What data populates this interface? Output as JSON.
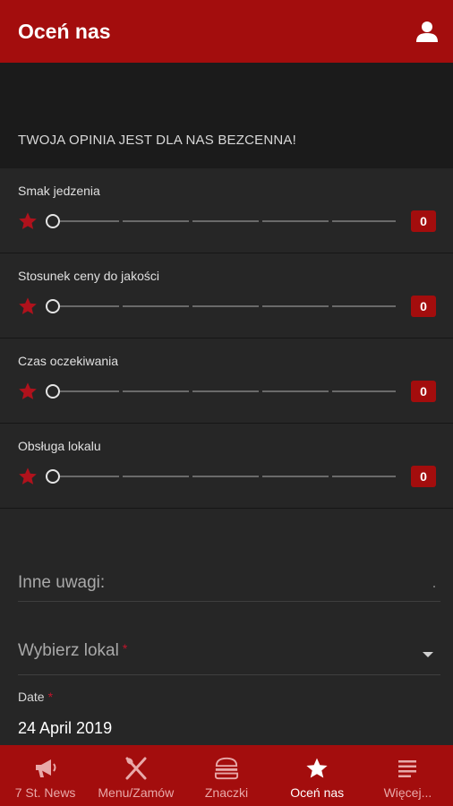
{
  "header": {
    "title": "Oceń nas",
    "user_icon": "user-icon"
  },
  "banner": {
    "text": "TWOJA OPINIA JEST DLA NAS BEZCENNA!"
  },
  "ratings": [
    {
      "label": "Smak jedzenia",
      "value": "0"
    },
    {
      "label": "Stosunek ceny do jakości",
      "value": "0"
    },
    {
      "label": "Czas oczekiwania",
      "value": "0"
    },
    {
      "label": "Obsługa lokalu",
      "value": "0"
    }
  ],
  "form": {
    "notes_placeholder": "Inne uwagi:",
    "location_placeholder": "Wybierz lokal",
    "required_mark": "*",
    "date_label": "Date",
    "date_value": "24 April 2019"
  },
  "tabs": [
    {
      "label": "7 St. News",
      "icon": "megaphone-icon",
      "active": false
    },
    {
      "label": "Menu/Zamów",
      "icon": "fork-knife-icon",
      "active": false
    },
    {
      "label": "Znaczki",
      "icon": "burger-icon",
      "active": false
    },
    {
      "label": "Oceń nas",
      "icon": "star-icon",
      "active": true
    },
    {
      "label": "Więcej...",
      "icon": "list-icon",
      "active": false
    }
  ],
  "colors": {
    "accent": "#a30d0d",
    "background": "#262626",
    "banner": "#1b1b1b"
  }
}
